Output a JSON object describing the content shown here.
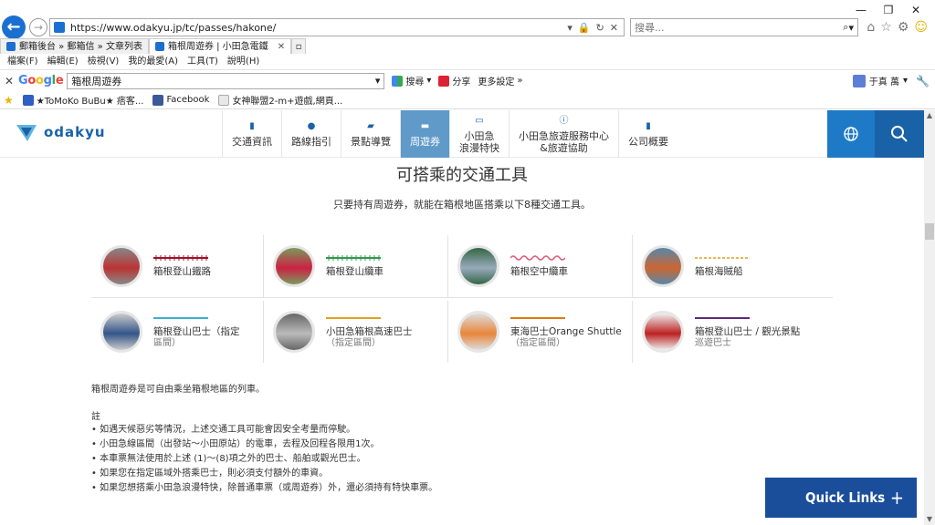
{
  "browser": {
    "url": "https://www.odakyu.jp/tc/passes/hakone/",
    "search_placeholder": "搜尋...",
    "window_controls": [
      "—",
      "❐",
      "✕"
    ],
    "tabs": [
      {
        "label": "郵箱後台 » 郵箱信 » 文章列表",
        "active": false
      },
      {
        "label": "箱根周遊券 | 小田急電鐵",
        "active": true
      }
    ],
    "menu": [
      "檔案(F)",
      "編輯(E)",
      "檢視(V)",
      "我的最愛(A)",
      "工具(T)",
      "說明(H)"
    ],
    "google_bar": {
      "query": "箱根周遊券",
      "search_label": "搜尋",
      "share_label": "分享",
      "more_label": "更多設定",
      "user": "于真 萬"
    },
    "favorites": [
      {
        "label": "★ToMoKo BuBu★ 痞客...",
        "color": "#2d5fc4"
      },
      {
        "label": "Facebook",
        "color": "#3b5998"
      },
      {
        "label": "女神聯盟2-m+遊戲,網頁...",
        "color": "#e8e8e8"
      }
    ]
  },
  "site": {
    "logo_text": "odakyu",
    "nav": [
      {
        "label": "交通資訊",
        "icon": "train-icon",
        "glyph": "▮",
        "active": false
      },
      {
        "label": "路線指引",
        "icon": "pin-icon",
        "glyph": "●",
        "active": false
      },
      {
        "label": "景點導覽",
        "icon": "map-icon",
        "glyph": "▰",
        "active": false
      },
      {
        "label": "周遊券",
        "icon": "ticket-icon",
        "glyph": "▬",
        "active": true
      },
      {
        "label": "小田急\n浪漫特快",
        "icon": "romancecar-icon",
        "glyph": "▭",
        "active": false
      },
      {
        "label": "小田急旅遊服務中心\n&旅遊協助",
        "icon": "info-icon",
        "glyph": "ⓘ",
        "active": false
      },
      {
        "label": "公司概要",
        "icon": "building-icon",
        "glyph": "▮",
        "active": false
      }
    ]
  },
  "main": {
    "title": "可搭乘的交通工具",
    "subtitle": "只要持有周遊券，就能在箱根地區搭乘以下8種交通工具。",
    "transports": [
      {
        "label": "箱根登山鐵路",
        "note": "",
        "line_color": "#a0102a",
        "line_style": "ticked",
        "photo": [
          "#b33",
          "#888"
        ]
      },
      {
        "label": "箱根登山纜車",
        "note": "",
        "line_color": "#2f9a4a",
        "line_style": "ticked",
        "photo": [
          "#c24",
          "#7a9b5c"
        ]
      },
      {
        "label": "箱根空中纜車",
        "note": "",
        "line_color": "#e05a7a",
        "line_style": "wave",
        "photo": [
          "#9ab",
          "#364"
        ]
      },
      {
        "label": "箱根海賊船",
        "note": "",
        "line_color": "#e0a020",
        "line_style": "dashed",
        "photo": [
          "#c63",
          "#58a"
        ]
      },
      {
        "label": "箱根登山巴士（指定",
        "note": "區間）",
        "line_color": "#3ab0d0",
        "line_style": "solid",
        "photo": [
          "#358",
          "#ccc"
        ]
      },
      {
        "label": "小田急箱根高速巴士",
        "note": "（指定區間）",
        "line_color": "#e0a020",
        "line_style": "solid",
        "photo": [
          "#bbb",
          "#666"
        ]
      },
      {
        "label": "東海巴士Orange Shuttle",
        "note": "（指定區間）",
        "line_color": "#e07a10",
        "line_style": "solid",
        "photo": [
          "#e8853a",
          "#ddd"
        ]
      },
      {
        "label": "箱根登山巴士 / 觀光景點",
        "note": "巡遊巴士",
        "line_color": "#5a2a7a",
        "line_style": "solid",
        "photo": [
          "#b22",
          "#eee"
        ]
      }
    ],
    "description": "箱根周遊券是可自由乘坐箱根地區的列車。",
    "notes_title": "註",
    "notes": [
      "• 如遇天候惡劣等情況，上述交通工具可能會因安全考量而停駛。",
      "• 小田急線區間（出發站～小田原站）的電車，去程及回程各限用1次。",
      "• 本車票無法使用於上述 (1)～(8)項之外的巴士、船舶或觀光巴士。",
      "• 如果您在指定區域外搭乘巴士，則必須支付額外的車資。",
      "• 如果您想搭乘小田急浪漫特快，除普通車票（或周遊券）外，還必須持有特快車票。"
    ],
    "quick_links": "Quick Links"
  }
}
